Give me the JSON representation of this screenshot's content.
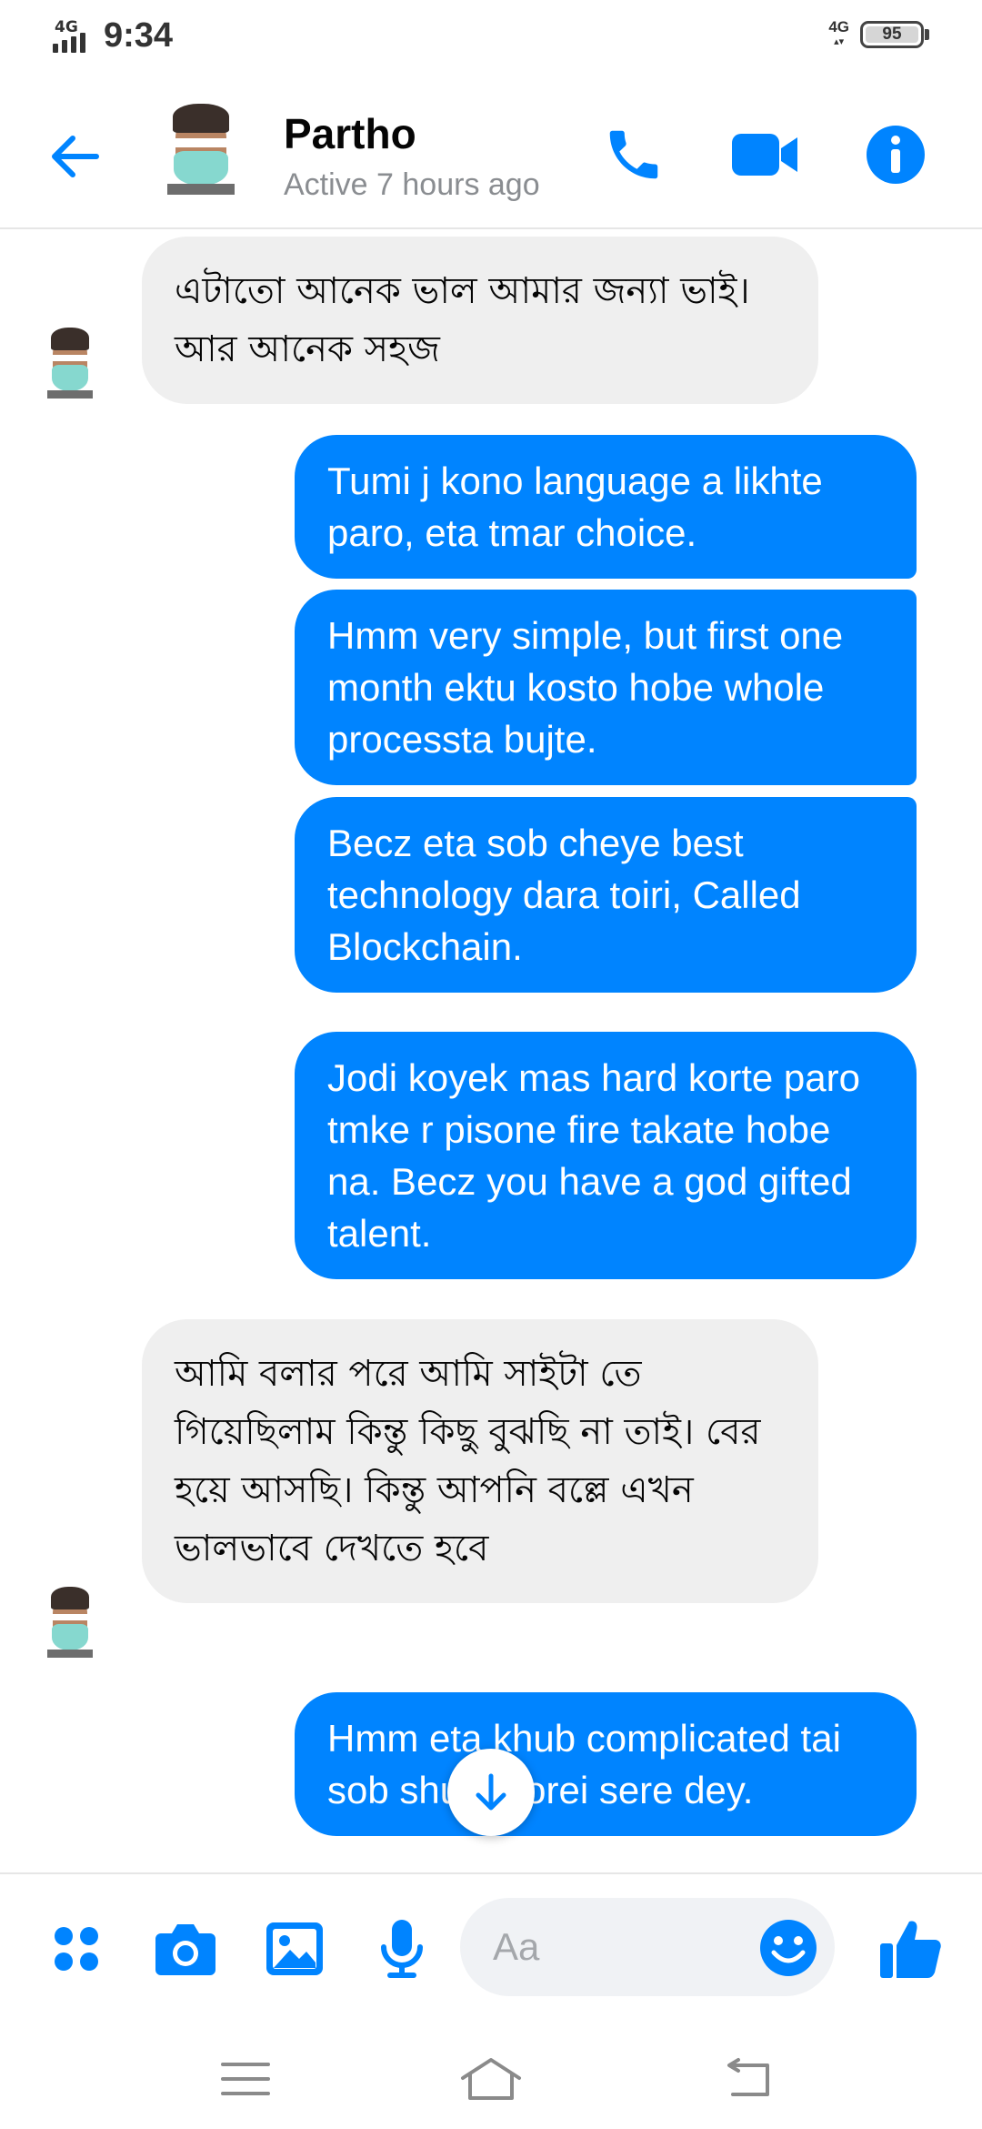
{
  "status_bar": {
    "network": "4G",
    "time": "9:34",
    "network_right": "4G",
    "battery": "95"
  },
  "header": {
    "contact_name": "Partho",
    "contact_status": "Active 7 hours ago",
    "icons": [
      "back-arrow-icon",
      "phone-icon",
      "video-camera-icon",
      "info-icon"
    ]
  },
  "messages": [
    {
      "direction": "incoming",
      "text": "এটাতো আনেক ভাল আমার জন্যা ভাই। আর আনেক সহজ"
    },
    {
      "direction": "outgoing",
      "text": "Tumi j kono language a likhte paro, eta tmar choice."
    },
    {
      "direction": "outgoing",
      "text": "Hmm very simple, but first one month ektu kosto hobe whole processta bujte."
    },
    {
      "direction": "outgoing",
      "text": "Becz eta sob cheye best technology dara toiri, Called Blockchain."
    },
    {
      "direction": "outgoing",
      "text": "Jodi koyek mas hard korte paro tmke r pisone fire takate hobe na. Becz you have a god gifted talent."
    },
    {
      "direction": "incoming",
      "text": "আমি বলার পরে আমি সাইটা তে গিয়েছিলাম কিন্তু কিছু বুঝছি না তাই। বের হয়ে আসছি।  কিন্তু আপনি বল্লে এখন ভালভাবে দেখতে হবে"
    },
    {
      "direction": "outgoing",
      "text": "Hmm eta khub complicated tai sob shuru korei sere dey."
    }
  ],
  "composer": {
    "placeholder": "Aa",
    "icons": [
      "apps-grid-icon",
      "camera-icon",
      "gallery-icon",
      "microphone-icon",
      "emoji-icon",
      "thumbs-up-icon"
    ]
  },
  "nav_bar": {
    "icons": [
      "menu-icon",
      "home-icon",
      "back-icon"
    ]
  },
  "colors": {
    "accent": "#0084ff",
    "incoming_bubble": "#efefef",
    "outgoing_bubble": "#0084ff"
  }
}
